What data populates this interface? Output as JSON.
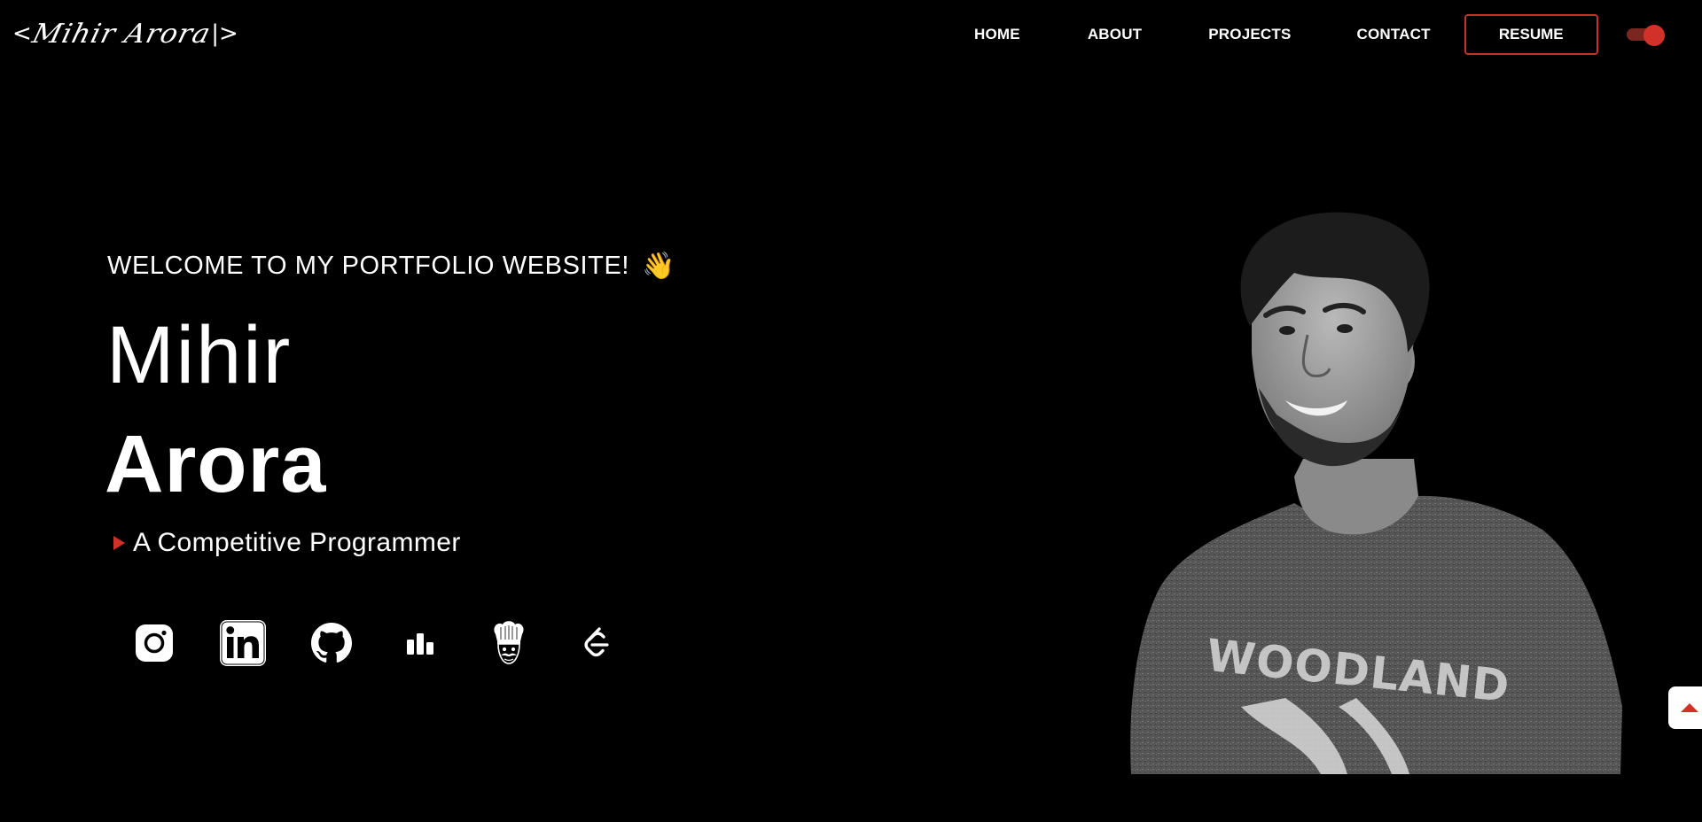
{
  "logo": {
    "open_bracket": "<",
    "signature": "Mihir Arora",
    "close_bracket": "|>"
  },
  "nav": {
    "items": [
      {
        "label": "HOME"
      },
      {
        "label": "ABOUT"
      },
      {
        "label": "PROJECTS"
      },
      {
        "label": "CONTACT"
      }
    ],
    "resume_label": "RESUME"
  },
  "theme_toggle": {
    "state": "on",
    "accent": "#d2312a"
  },
  "hero": {
    "welcome": "WELCOME TO MY PORTFOLIO WEBSITE!",
    "wave_emoji": "👋",
    "first_name": "Mihir",
    "last_name": "Arora",
    "tagline": "A Competitive Programmer"
  },
  "socials": [
    {
      "icon": "instagram-icon"
    },
    {
      "icon": "linkedin-icon"
    },
    {
      "icon": "github-icon"
    },
    {
      "icon": "codeforces-icon"
    },
    {
      "icon": "codechef-icon"
    },
    {
      "icon": "leetcode-icon"
    }
  ],
  "colors": {
    "background": "#000000",
    "text": "#ffffff",
    "accent": "#d2312a"
  }
}
